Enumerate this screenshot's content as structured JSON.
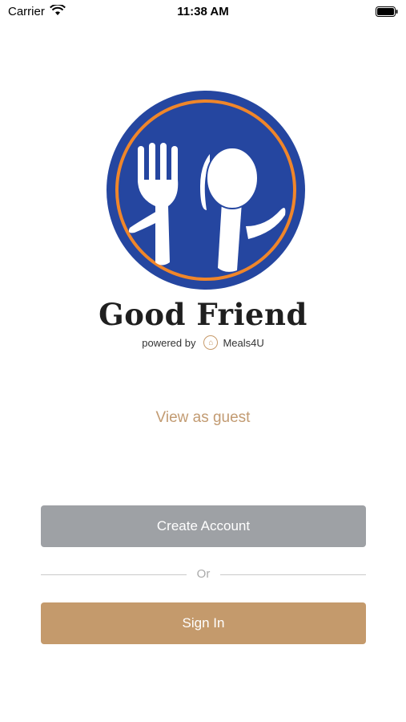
{
  "status_bar": {
    "carrier": "Carrier",
    "time": "11:38 AM"
  },
  "brand": {
    "name": "Good Friend",
    "powered_by": "powered by",
    "partner": "Meals4U",
    "colors": {
      "circle": "#2546a0",
      "ring": "#f0862a",
      "accent": "#c49a6c"
    }
  },
  "actions": {
    "guest_label": "View as guest",
    "create_label": "Create Account",
    "or_label": "Or",
    "signin_label": "Sign In"
  }
}
